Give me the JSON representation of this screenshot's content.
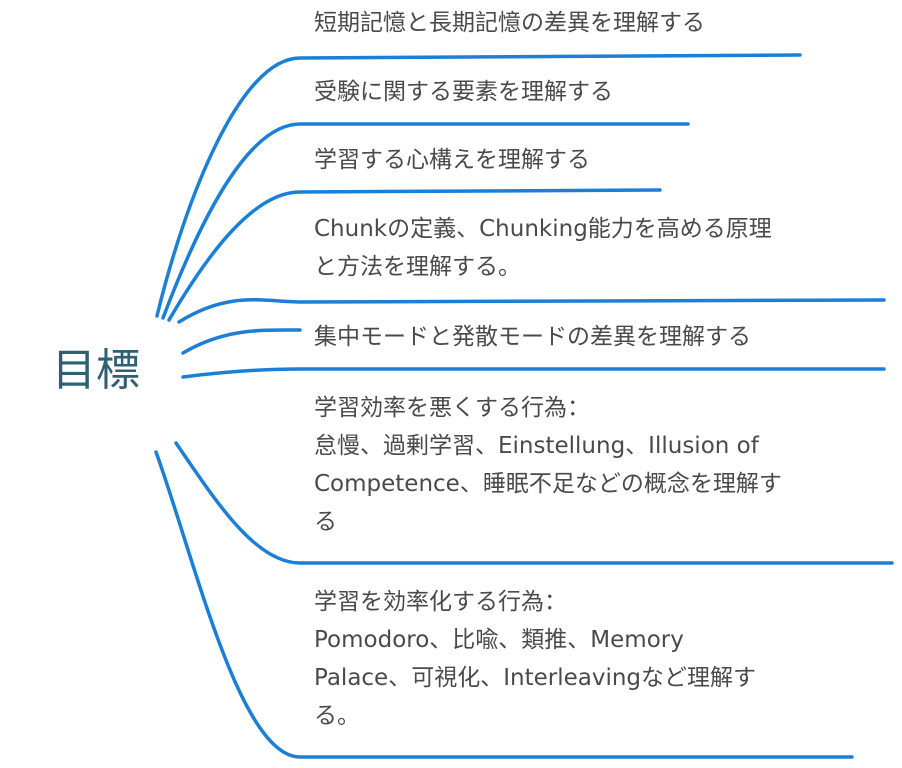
{
  "root": {
    "label": "目標"
  },
  "branches": [
    {
      "text": "短期記憶と長期記憶の差異を理解する"
    },
    {
      "text": "受験に関する要素を理解する"
    },
    {
      "text": "学習する心構えを理解する"
    },
    {
      "text": "Chunkの定義、Chunking能力を高める原理\nと方法を理解する。"
    },
    {
      "text": "集中モードと発散モードの差異を理解する"
    },
    {
      "text": "学習効率を悪くする行為：\n怠慢、過剰学習、Einstellung、Illusion of\nCompetence、睡眠不足などの概念を理解す\nる"
    },
    {
      "text": "学習を効率化する行為：\nPomodoro、比喩、類推、Memory\nPalace、可視化、Interleavingなど理解す\nる。"
    }
  ],
  "colors": {
    "connector": "#1c7fd6",
    "root_text": "#2f5f73",
    "branch_text": "#4a4a4a"
  }
}
